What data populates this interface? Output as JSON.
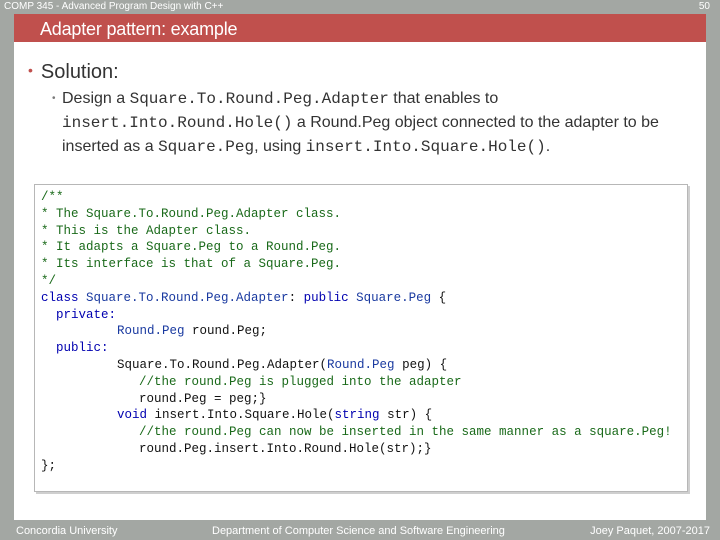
{
  "header": {
    "course": "COMP 345 - Advanced Program Design with C++",
    "page_number": "50"
  },
  "slide": {
    "title": "Adapter pattern: example",
    "bullet1": "Solution:",
    "bullet2": {
      "t1": "Design a ",
      "c1": "Square.To.Round.Peg.Adapter",
      "t2": " that enables to ",
      "c2": "insert.Into.Round.Hole()",
      "t3": " a Round.Peg object connected to the adapter to be inserted as a ",
      "c3": "Square.Peg",
      "t4": ", using ",
      "c4": "insert.Into.Square.Hole()",
      "t5": "."
    }
  },
  "code": {
    "l1": "/**",
    "l2": "* The Square.To.Round.Peg.Adapter class.",
    "l3": "* This is the Adapter class.",
    "l4": "* It adapts a Square.Peg to a Round.Peg.",
    "l5": "* Its interface is that of a Square.Peg.",
    "l6": "*/",
    "l7a": "class ",
    "l7b": "Square.To.Round.Peg.Adapter",
    "l7c": ": ",
    "l7d": "public ",
    "l7e": "Square.Peg",
    "l7f": " {",
    "l8": "private:",
    "l9a": "Round.Peg",
    "l9b": " round.Peg;",
    "l10": "public:",
    "l11a": "Square.To.Round.Peg.Adapter(",
    "l11b": "Round.Peg",
    "l11c": " peg) {",
    "l12": "//the round.Peg is plugged into the adapter",
    "l13": "round.Peg = peg;}",
    "l14a": "void",
    "l14b": " insert.Into.Square.Hole(",
    "l14c": "string",
    "l14d": " str) {",
    "l15": "//the round.Peg can now be inserted in the same manner as a square.Peg!",
    "l16": "round.Peg.insert.Into.Round.Hole(str);}",
    "l17": "};"
  },
  "footer": {
    "left": "Concordia University",
    "center": "Department of Computer Science and Software Engineering",
    "right": "Joey Paquet, 2007-2017"
  },
  "colors": {
    "frame": "#a3a7a3",
    "title_bar": "#c0504d",
    "comment": "#1a6a1a",
    "keyword": "#0000b0"
  }
}
